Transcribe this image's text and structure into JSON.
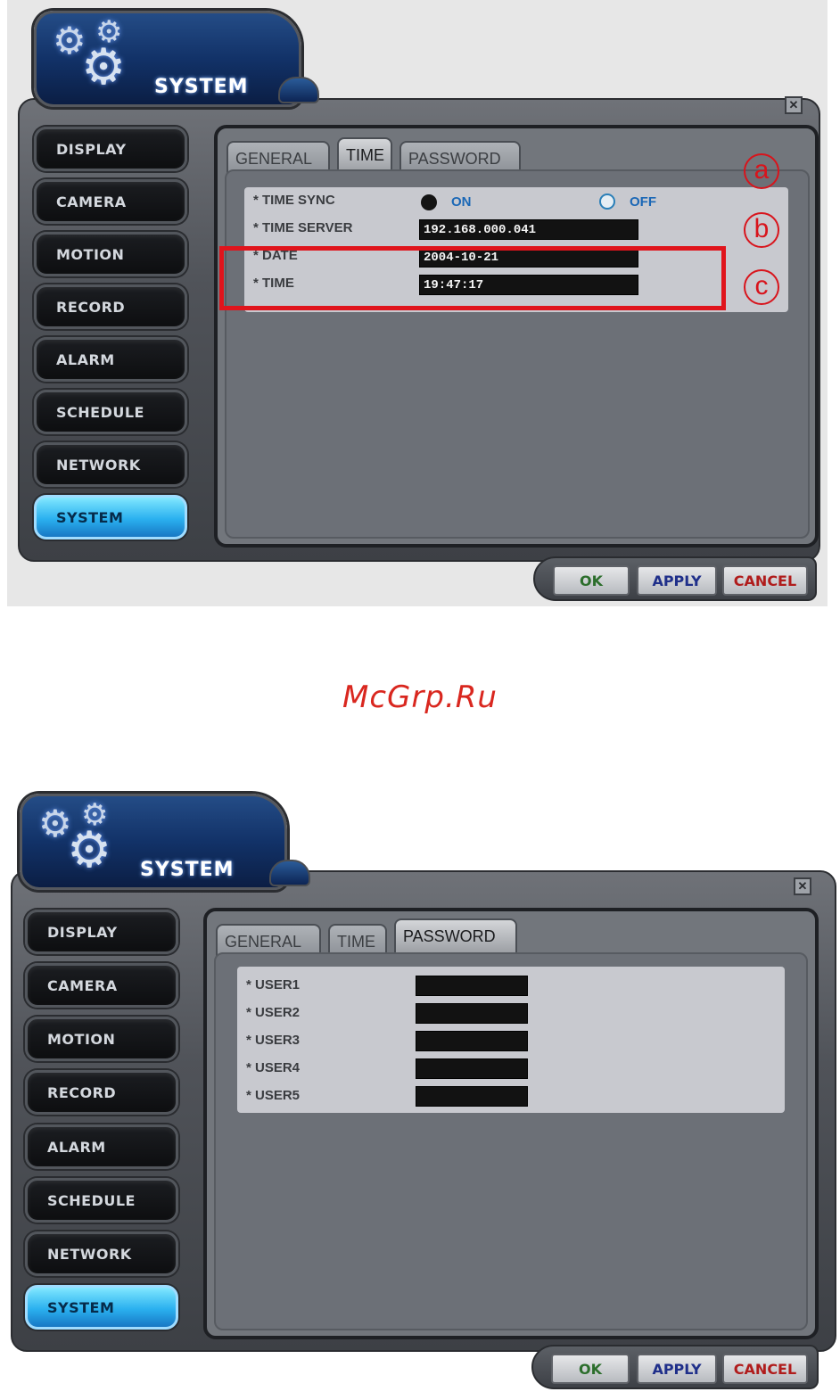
{
  "screens": [
    {
      "title": "SYSTEM",
      "close_glyph": "✕",
      "sidebar": [
        "DISPLAY",
        "CAMERA",
        "MOTION",
        "RECORD",
        "ALARM",
        "SCHEDULE",
        "NETWORK",
        "SYSTEM"
      ],
      "active_sidebar": "SYSTEM",
      "tabs": [
        "GENERAL",
        "TIME",
        "PASSWORD"
      ],
      "active_tab": "TIME",
      "fields": {
        "time_sync_label": "* TIME SYNC",
        "time_sync_on": "ON",
        "time_sync_off": "OFF",
        "time_sync_selected": "ON",
        "time_server_label": "* TIME SERVER",
        "time_server_value": "192.168.000.041",
        "date_label": "* DATE",
        "date_value": "2004-10-21",
        "time_label": "* TIME",
        "time_value": "19:47:17"
      },
      "annotations": [
        "a",
        "b",
        "c"
      ],
      "footer": {
        "ok": "OK",
        "apply": "APPLY",
        "cancel": "CANCEL"
      }
    },
    {
      "title": "SYSTEM",
      "close_glyph": "✕",
      "sidebar": [
        "DISPLAY",
        "CAMERA",
        "MOTION",
        "RECORD",
        "ALARM",
        "SCHEDULE",
        "NETWORK",
        "SYSTEM"
      ],
      "active_sidebar": "SYSTEM",
      "tabs": [
        "GENERAL",
        "TIME",
        "PASSWORD"
      ],
      "active_tab": "PASSWORD",
      "users": [
        "* USER1",
        "* USER2",
        "* USER3",
        "* USER4",
        "* USER5"
      ],
      "footer": {
        "ok": "OK",
        "apply": "APPLY",
        "cancel": "CANCEL"
      }
    }
  ],
  "watermark": "McGrp.Ru",
  "colors": {
    "annotation_red": "#e0141c",
    "active_button_cyan": "#2ab0ef",
    "radio_blue": "#2a7fb8"
  },
  "icons": {
    "header": "gears-icon"
  }
}
